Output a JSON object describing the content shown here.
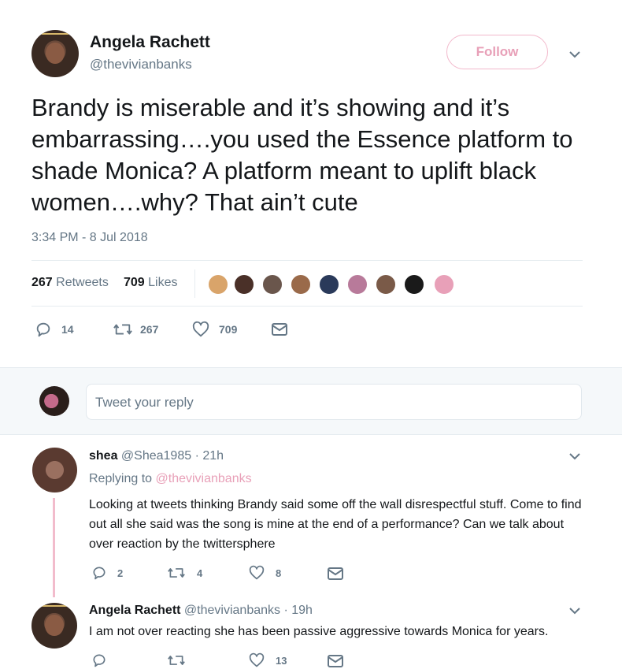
{
  "tweet": {
    "author_name": "Angela Rachett",
    "author_handle": "@thevivianbanks",
    "follow_label": "Follow",
    "text": "Brandy is miserable and it’s showing and it’s embarrassing….you used the Essence platform to shade Monica? A platform meant to uplift black women….why? That ain’t cute",
    "timestamp": "3:34 PM - 8 Jul 2018",
    "retweets_count": "267",
    "retweets_label": "Retweets",
    "likes_count": "709",
    "likes_label": "Likes",
    "actions": {
      "replies": "14",
      "retweets": "267",
      "likes": "709"
    }
  },
  "reply_box": {
    "placeholder": "Tweet your reply"
  },
  "replies": [
    {
      "name": "shea",
      "handle": "@Shea1985",
      "time": "· 21h",
      "replying_prefix": "Replying to",
      "replying_to": "@thevivianbanks",
      "text": "Looking at tweets thinking Brandy said some off the wall disrespectful stuff. Come to find out all she said was the song is mine at the end of a performance? Can we talk about over reaction by the twittersphere",
      "actions": {
        "replies": "2",
        "retweets": "4",
        "likes": "8"
      }
    },
    {
      "name": "Angela Rachett",
      "handle": "@thevivianbanks",
      "time": "· 19h",
      "text": "I am not over reacting she has been passive aggressive towards Monica for years.",
      "actions": {
        "replies": "",
        "retweets": "",
        "likes": "13"
      }
    }
  ],
  "colors": {
    "accent_pink": "#e8a0b8",
    "follow_border": "#f2b8cb",
    "muted": "#657786",
    "text": "#14171a",
    "divider": "#e6ecf0",
    "reply_area_bg": "#f5f8fa"
  },
  "icons": [
    "chevron-down-icon",
    "reply-icon",
    "retweet-icon",
    "heart-icon",
    "dm-envelope-icon"
  ]
}
